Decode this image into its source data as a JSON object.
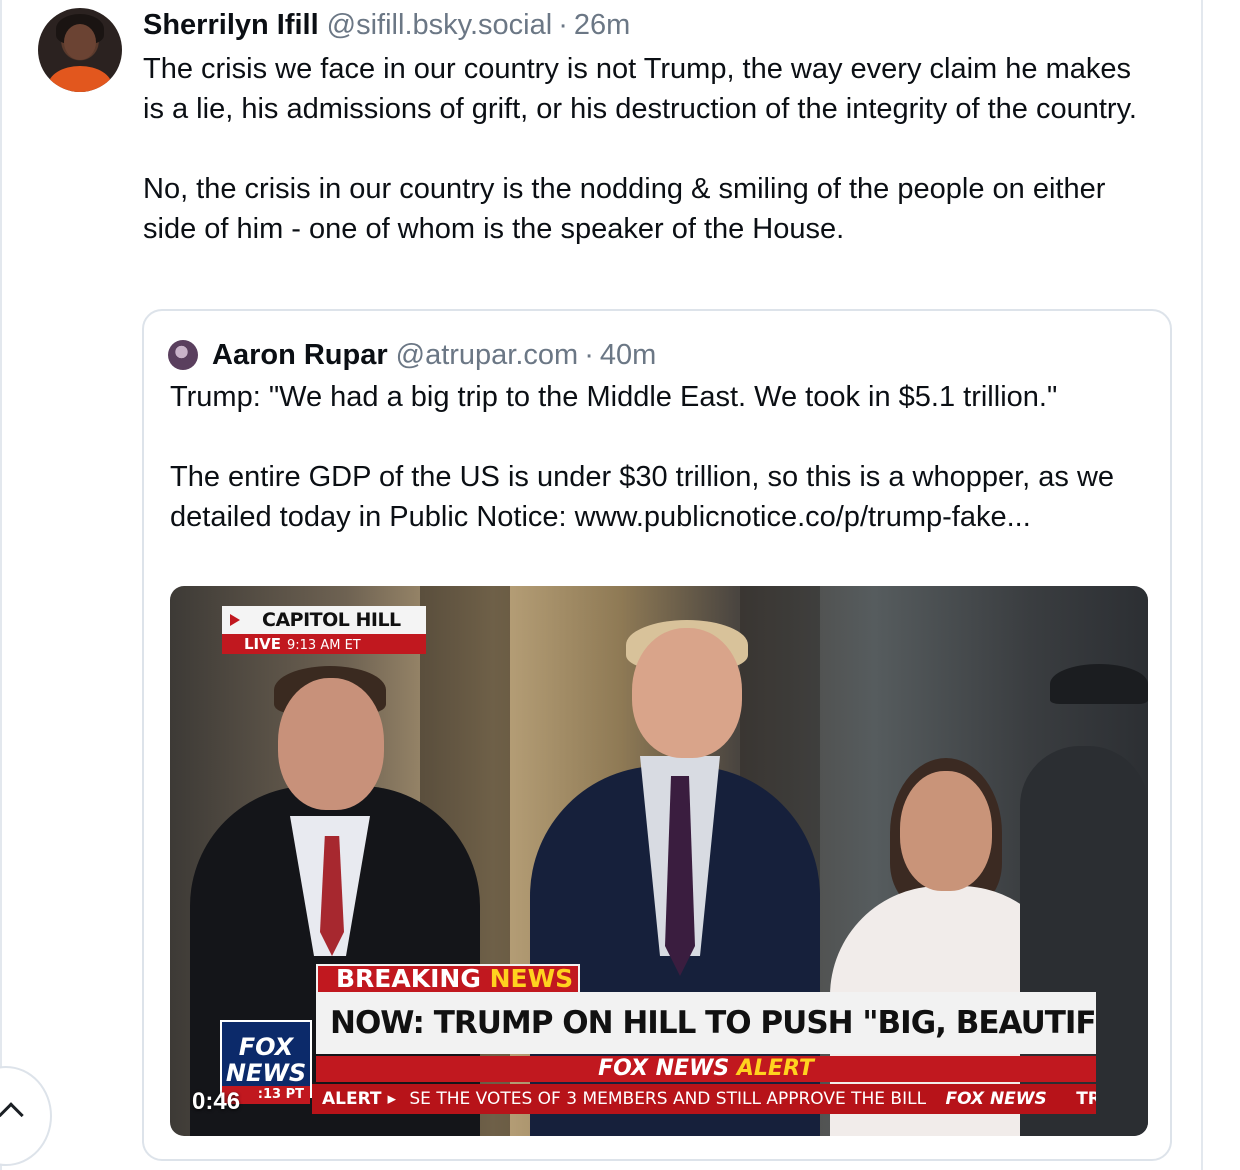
{
  "post": {
    "author": "Sherrilyn Ifill",
    "handle": "@sifill.bsky.social",
    "separator": "·",
    "time": "26m",
    "paragraphs": [
      "The crisis we face in our country is not Trump, the way every claim he makes is a lie, his admissions of grift, or his destruction of the integrity of the country.",
      "No, the crisis in our country is  the nodding & smiling of the people on either side of him - one of whom is the speaker of the House."
    ]
  },
  "quote": {
    "author": "Aaron Rupar",
    "handle": "@atrupar.com",
    "separator": "·",
    "time": "40m",
    "paragraphs": [
      "Trump: \"We had a big trip to the Middle East. We took in $5.1 trillion.\"",
      "The entire GDP of the US is under $30 trillion, so this is a whopper, as we detailed today in Public Notice: www.publicnotice.co/p/trump-fake..."
    ],
    "video": {
      "duration": "0:46",
      "location_tag": "CAPITOL HILL",
      "live_label": "LIVE",
      "live_time": "9:13 AM ET",
      "breaking_word1": "BREAKING",
      "breaking_word2": "NEWS",
      "headline": "NOW: TRUMP ON HILL TO PUSH \"BIG, BEAUTIFUL BILL\"",
      "alert_brand": "FOX NEWS",
      "alert_word": "ALERT",
      "ticker_label": "ALERT ▸",
      "ticker_text": "SE THE VOTES OF 3 MEMBERS AND STILL APPROVE THE BILL",
      "ticker_brand": "FOX NEWS",
      "ticker_tail": "TRUM",
      "logo_line1": "FOX",
      "logo_line2": "NEWS",
      "logo_time": ":13 PT"
    }
  },
  "icons": {
    "scroll_top": "chevron-up-icon"
  },
  "colors": {
    "text": "#0b0f14",
    "muted": "#6b7785",
    "border": "#dde3ea",
    "fox_red": "#c1181f"
  }
}
